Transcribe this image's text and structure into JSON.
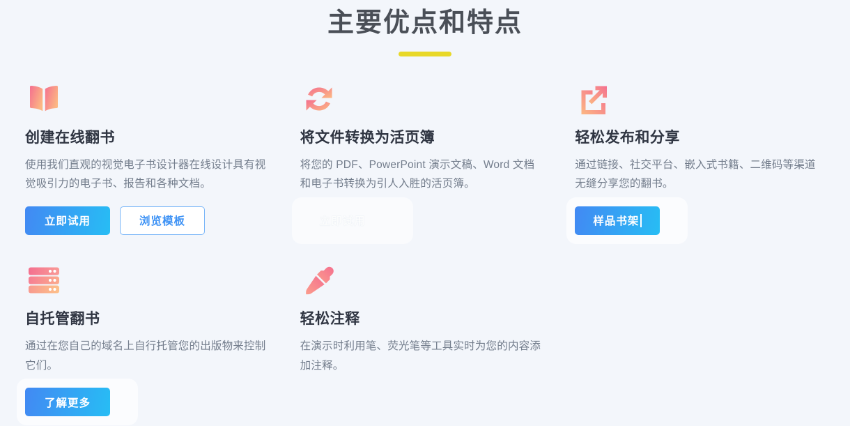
{
  "section": {
    "title": "主要优点和特点",
    "accent_underline_color": "#e8d828",
    "background_color": "#f3f6fb"
  },
  "theme": {
    "title_color": "#2f3542",
    "desc_color": "#737d8c",
    "primary_gradient_start": "#4289f3",
    "primary_gradient_end": "#27bdf4",
    "icon_gradient_start": "#f4708f",
    "icon_gradient_end": "#fcb07a"
  },
  "features": [
    {
      "icon": "open-book-icon",
      "title": "创建在线翻书",
      "desc": "使用我们直观的视觉电子书设计器在线设计具有视觉吸引力的电子书、报告和各种文档。",
      "buttons": [
        {
          "label": "立即试用",
          "style": "primary",
          "name": "try-now-button"
        },
        {
          "label": "浏览模板",
          "style": "outline",
          "name": "browse-templates-button"
        }
      ]
    },
    {
      "icon": "sync-refresh-icon",
      "title": "将文件转换为活页簿",
      "desc": "将您的 PDF、PowerPoint 演示文稿、Word 文档和电子书转换为引人入胜的活页簿。",
      "buttons": [
        {
          "label": "立即试用",
          "style": "ghost",
          "name": "try-now-button"
        }
      ]
    },
    {
      "icon": "external-link-icon",
      "title": "轻松发布和分享",
      "desc": "通过链接、社交平台、嵌入式书籍、二维码等渠道无缝分享您的翻书。",
      "buttons": [
        {
          "label": "样品书架",
          "style": "primary",
          "name": "sample-bookshelf-button",
          "caret": true
        }
      ]
    },
    {
      "icon": "server-stack-icon",
      "title": "自托管翻书",
      "desc": "通过在您自己的域名上自行托管您的出版物来控制它们。",
      "buttons": [
        {
          "label": "了解更多",
          "style": "primary",
          "name": "learn-more-button"
        }
      ]
    },
    {
      "icon": "marker-pen-icon",
      "title": "轻松注释",
      "desc": "在演示时利用笔、荧光笔等工具实时为您的内容添加注释。",
      "buttons": []
    }
  ]
}
